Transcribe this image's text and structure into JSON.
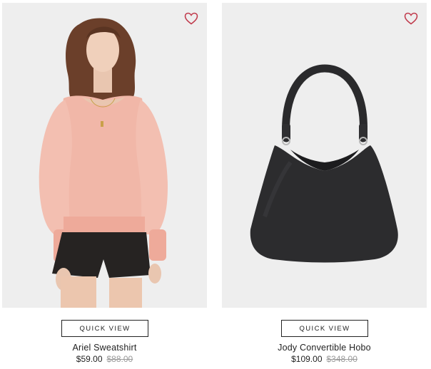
{
  "products": [
    {
      "name": "Ariel Sweatshirt",
      "sale_price": "$59.00",
      "original_price": "$88.00",
      "quick_view_label": "QUICK VIEW",
      "wishlist_icon": "heart-outline-icon",
      "image_subject": "model-wearing-pink-sweatshirt"
    },
    {
      "name": "Jody Convertible Hobo",
      "sale_price": "$109.00",
      "original_price": "$348.00",
      "quick_view_label": "QUICK VIEW",
      "wishlist_icon": "heart-outline-icon",
      "image_subject": "black-leather-hobo-bag"
    }
  ],
  "colors": {
    "wishlist_heart": "#c0394b",
    "image_background": "#eeeeee",
    "sweatshirt": "#f1b7a8",
    "bag": "#2c2c2e",
    "text": "#222222",
    "strike_price": "#9a9a9a"
  }
}
